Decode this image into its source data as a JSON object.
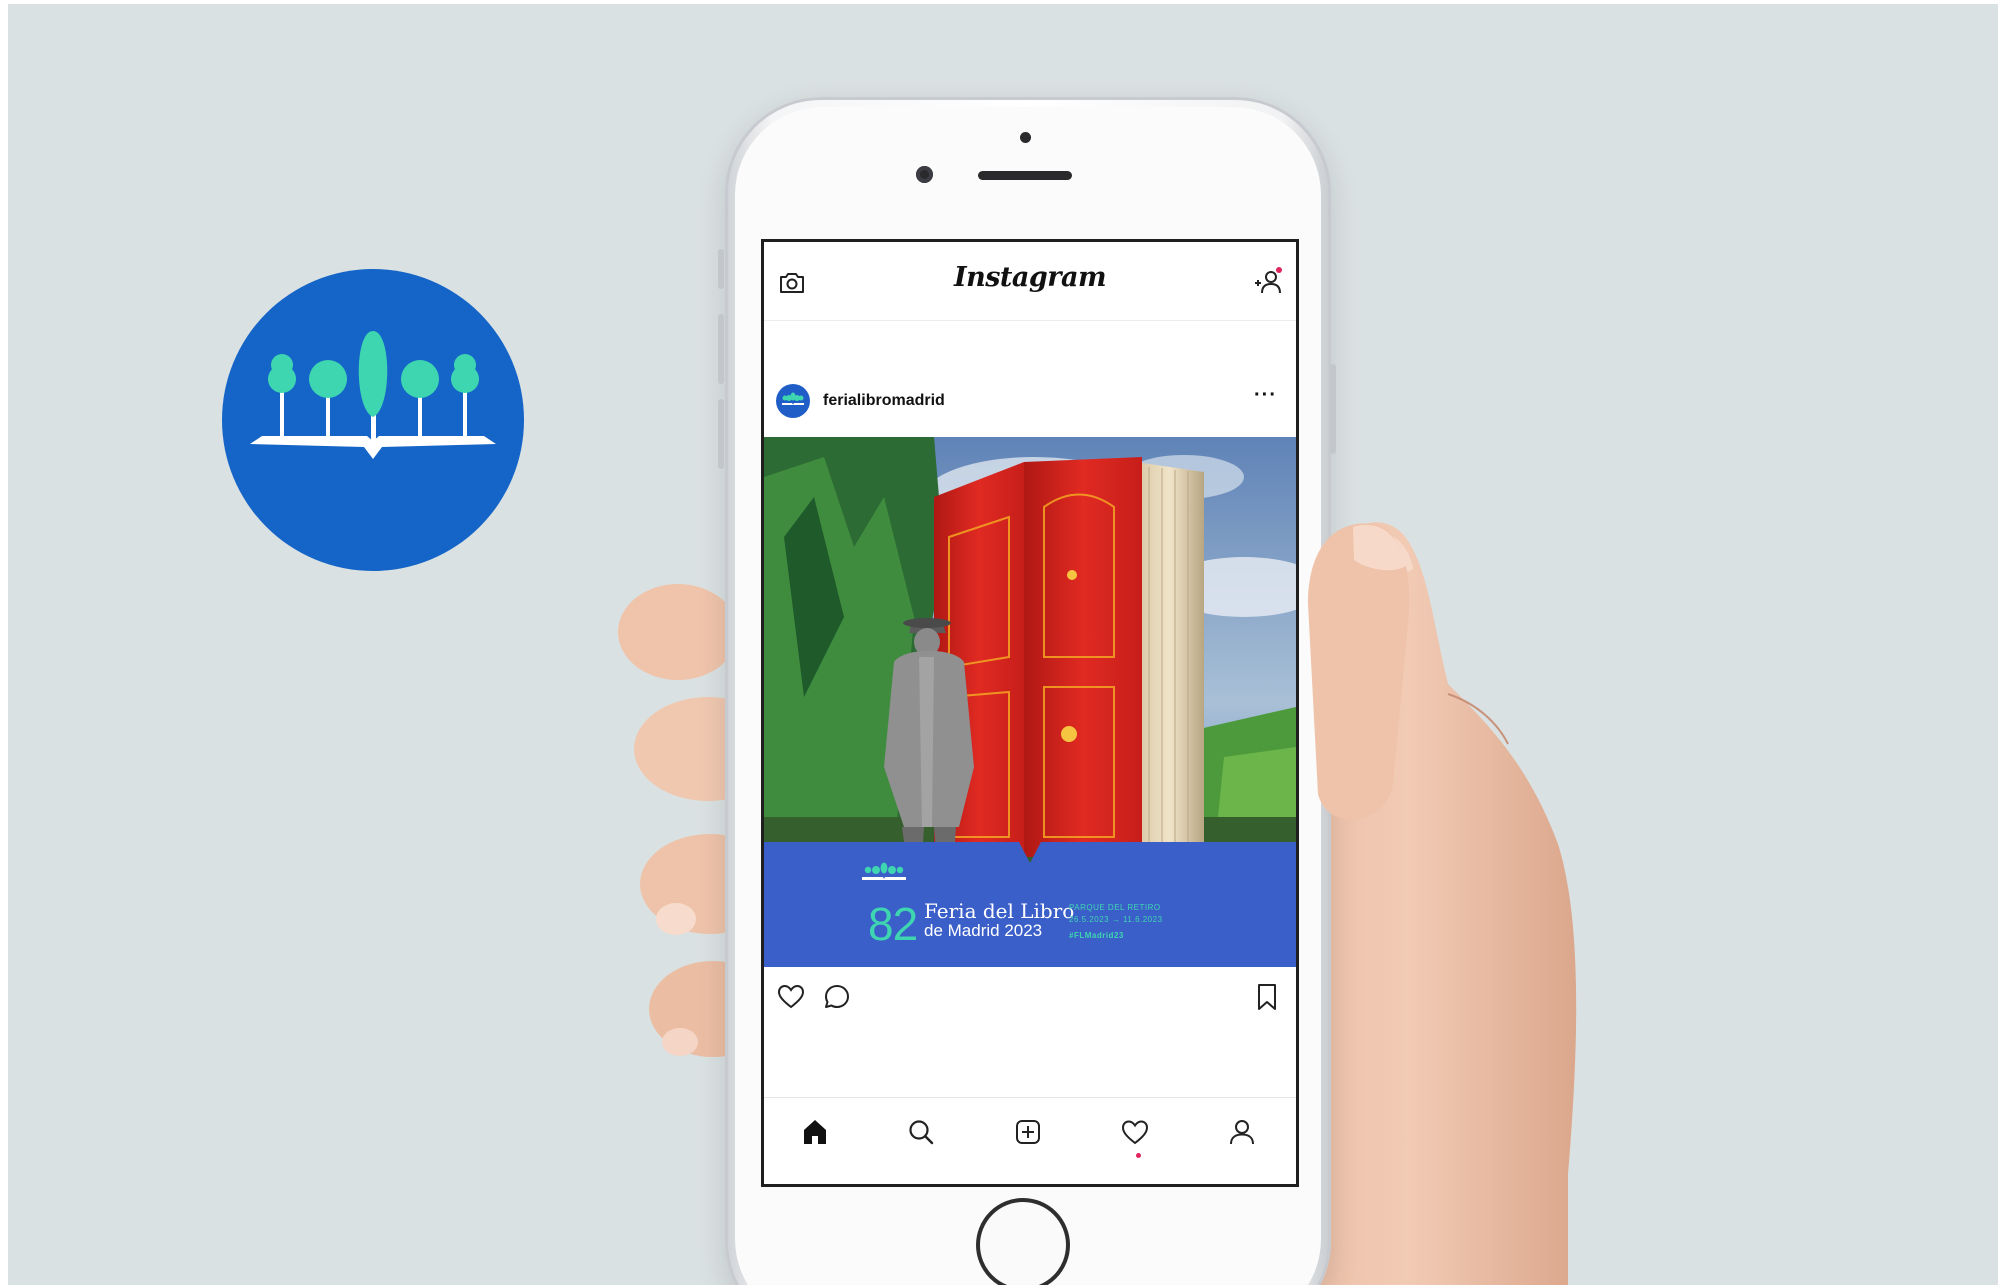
{
  "instagram": {
    "app_title": "Instagram",
    "post": {
      "username": "ferialibromadrid",
      "more_label": "···"
    },
    "banner": {
      "edition": "82",
      "title_line1": "Feria del Libro",
      "title_line2": "de Madrid 2023",
      "venue": "PARQUE DEL RETIRO",
      "dates": "26.5.2023 → 11.6.2023",
      "hashtag": "#FLMadrid23"
    },
    "header_icons": [
      "camera-icon",
      "add-user-icon"
    ],
    "action_icons": [
      "heart-icon",
      "comment-icon",
      "bookmark-icon"
    ],
    "tabs": [
      "home-icon",
      "search-icon",
      "add-post-icon",
      "activity-heart-icon",
      "profile-icon"
    ]
  },
  "colors": {
    "background": "#dae1e2",
    "brand_blue": "#1565c8",
    "banner_blue": "#3b5fc9",
    "brand_green": "#3ed6b0",
    "door_red": "#d9231f",
    "notification_red": "#e0245e"
  }
}
